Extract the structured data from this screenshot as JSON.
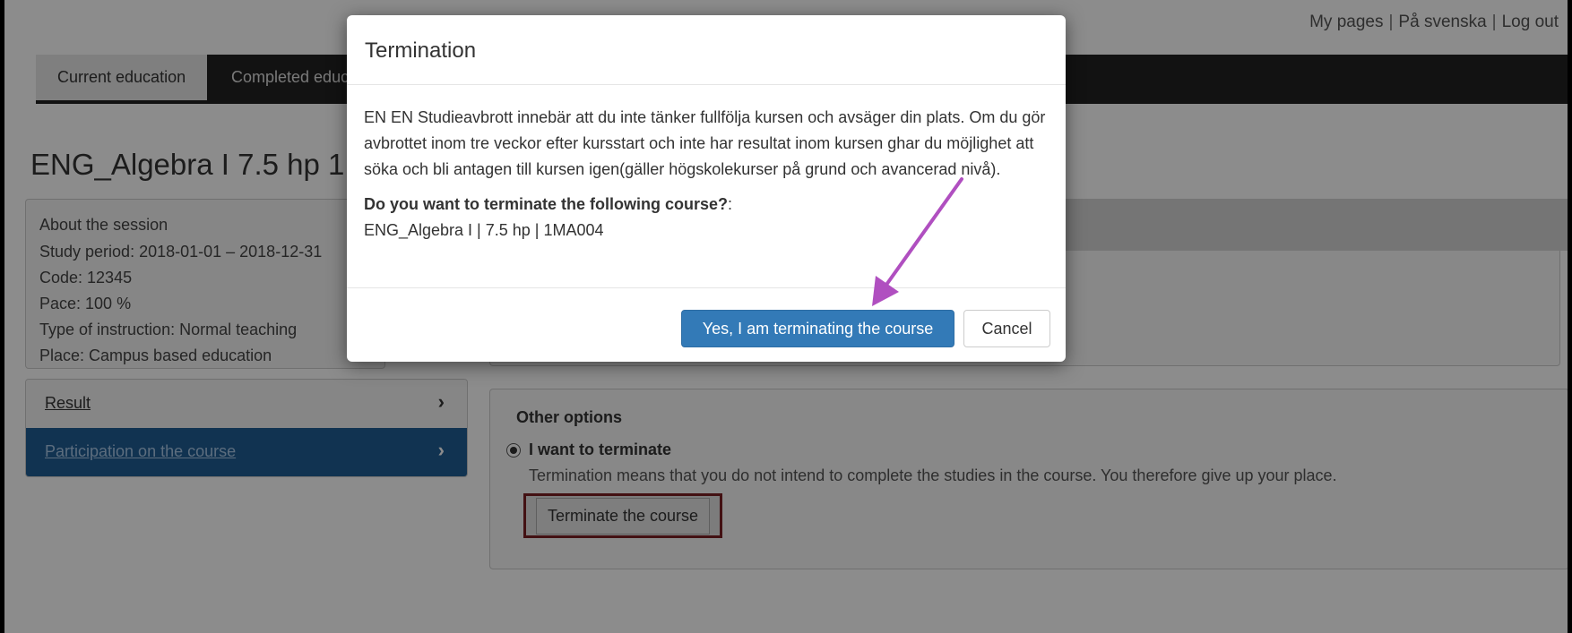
{
  "top_links": [
    "My pages",
    "På svenska",
    "Log out"
  ],
  "nav": {
    "tabs": [
      "Current education",
      "Completed educa"
    ]
  },
  "course": {
    "title": "ENG_Algebra I 7.5 hp 1MA004",
    "session": {
      "heading": "About the session",
      "study_period": "Study period:  2018-01-01 – 2018-12-31",
      "code": "Code:  12345",
      "pace": "Pace:  100 %",
      "instruction": "Type of instruction:  Normal teaching",
      "place": "Place:  Campus based education"
    }
  },
  "sidebar": {
    "items": [
      {
        "label": "Result"
      },
      {
        "label": "Participation on the course"
      }
    ]
  },
  "options": {
    "title": "Other options",
    "radio_label": "I want to terminate",
    "description": "Termination means that you do not intend to complete the studies in the course. You therefore give up your place.",
    "terminate_button": "Terminate the course"
  },
  "modal": {
    "title": "Termination",
    "body": "EN EN Studieavbrott innebär att du inte tänker fullfölja kursen och avsäger din plats. Om du gör avbrottet inom tre veckor efter kursstart och inte har resultat inom kursen ghar du möjlighet att söka och bli antagen till kursen igen(gäller högskolekurser på grund och avancerad nivå).",
    "question": "Do you want to terminate the following course?",
    "question_suffix": ":",
    "course_line": "ENG_Algebra I | 7.5 hp | 1MA004",
    "confirm_button": "Yes, I am terminating the course",
    "cancel_button": "Cancel"
  },
  "colors": {
    "primary": "#337ab7",
    "annotation_arrow": "#b04fc0",
    "highlight_border": "#7a1f24",
    "sidebar_active": "#1f5d94"
  }
}
